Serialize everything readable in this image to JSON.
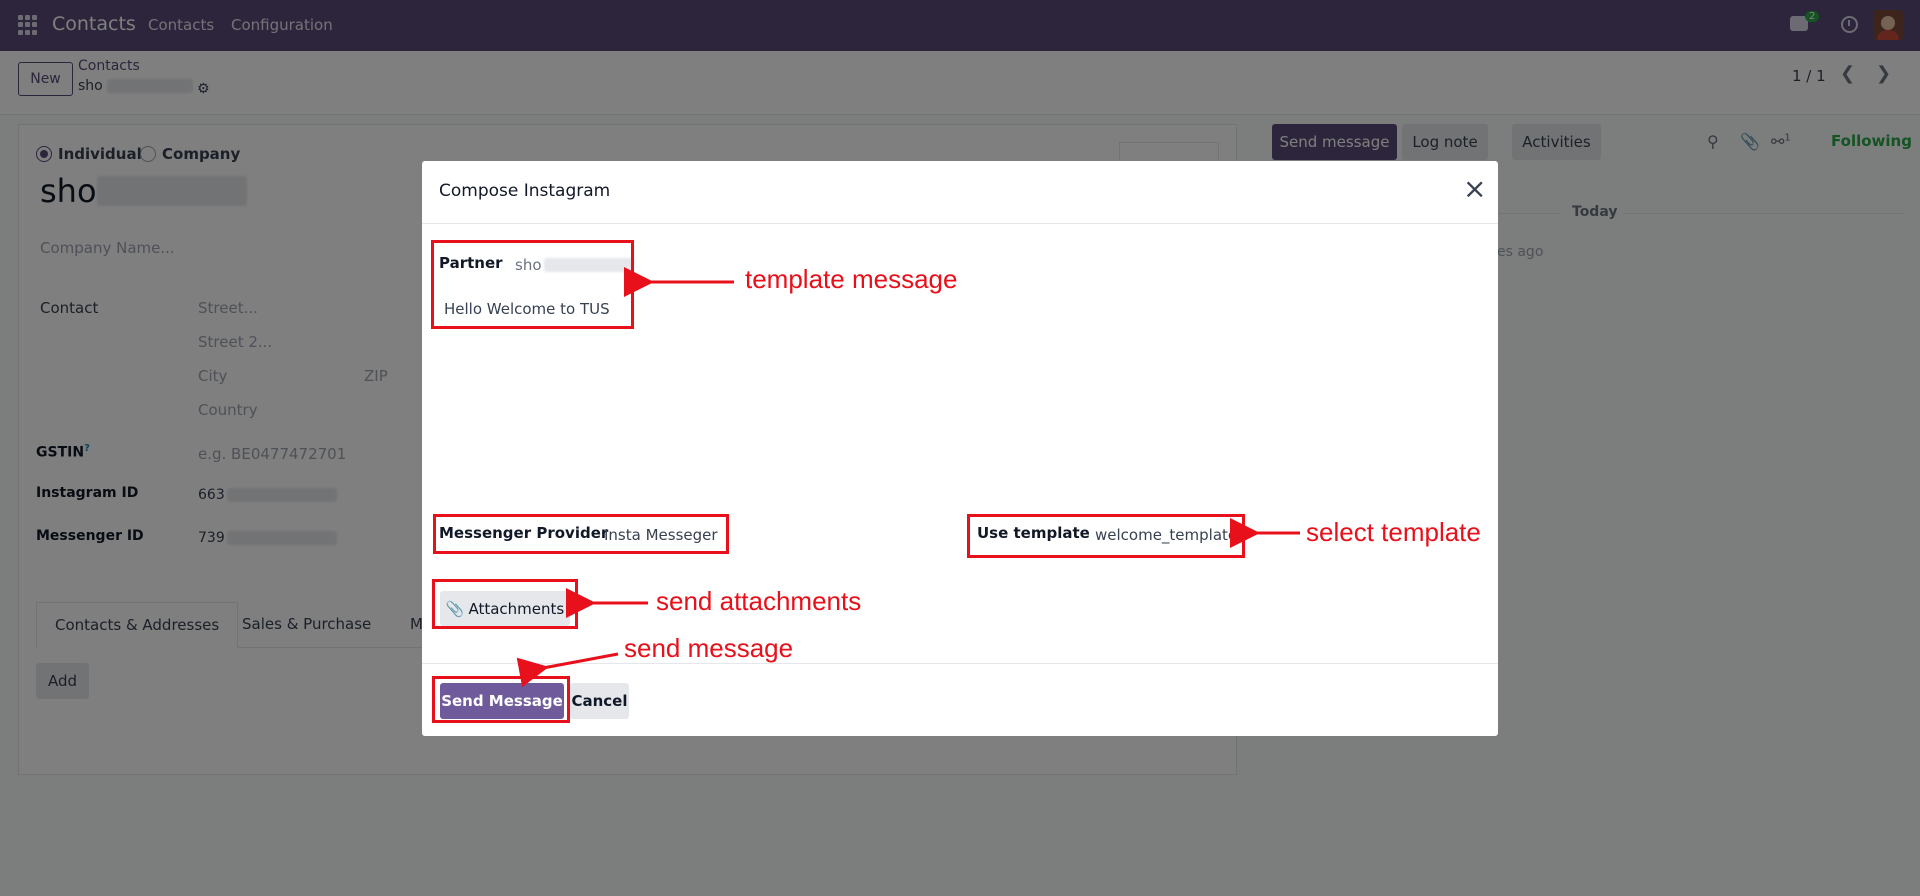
{
  "navbar": {
    "brand": "Contacts",
    "menu": [
      "Contacts",
      "Configuration"
    ],
    "chat_badge": "2"
  },
  "control_panel": {
    "new_label": "New",
    "breadcrumb": "Contacts",
    "record_prefix": "sho",
    "pager": "1 / 1"
  },
  "form": {
    "type_options": [
      "Individual",
      "Company"
    ],
    "selected_type": "Individual",
    "name_prefix": "sho",
    "company_placeholder": "Company Name...",
    "contact_label": "Contact",
    "address": {
      "street": "Street...",
      "street2": "Street 2...",
      "city": "City",
      "zip": "ZIP",
      "country": "Country"
    },
    "gstin_label": "GSTIN",
    "gstin_tooltip": "?",
    "gstin_placeholder": "e.g. BE0477472701",
    "instagram_label": "Instagram ID",
    "instagram_prefix": "663",
    "messenger_label": "Messenger ID",
    "messenger_prefix": "739",
    "tabs": [
      "Contacts & Addresses",
      "Sales & Purchase",
      "Mes"
    ],
    "add_label": "Add"
  },
  "chatter": {
    "send_message": "Send message",
    "log_note": "Log note",
    "activities": "Activities",
    "followers_count": "1",
    "following": "Following",
    "today": "Today",
    "time_ago": "es ago"
  },
  "modal": {
    "title": "Compose Instagram",
    "partner_label": "Partner",
    "partner_prefix": "sho",
    "body": "Hello Welcome to TUS",
    "provider_label": "Messenger Provider",
    "provider_value": "Insta Messeger",
    "template_label": "Use template",
    "template_value": "welcome_template",
    "attachments_label": "Attachments",
    "send_label": "Send Message",
    "cancel_label": "Cancel"
  },
  "annotations": {
    "template_message": "template message",
    "select_template": "select template",
    "send_attachments": "send attachments",
    "send_message": "send message",
    "color": "#e8101a"
  }
}
